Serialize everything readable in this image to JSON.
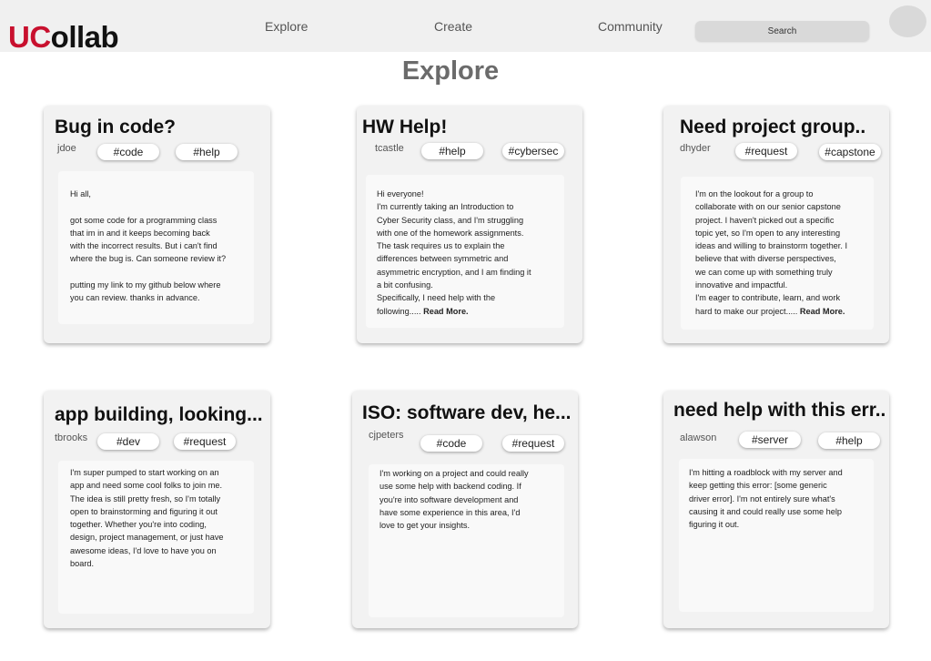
{
  "header": {
    "logo_accent": "UC",
    "logo_rest": "ollab",
    "nav": [
      "Explore",
      "Create",
      "Community"
    ],
    "search_placeholder": "Search"
  },
  "page_title": "Explore",
  "colors": {
    "brand_red": "#c8102e",
    "topbar": "#f0f0f0",
    "card": "#f2f2f2"
  },
  "posts": [
    {
      "title": "Bug in code?",
      "user": "jdoe",
      "tags": [
        "#code",
        "#help"
      ],
      "body": "Hi all,\n\ngot some code for a programming class\nthat im in and it keeps becoming back\nwith the incorrect results. But i can't find\nwhere the bug is. Can someone review it?\n\nputting my link to my github below where\nyou can review. thanks in advance.",
      "read_more": ""
    },
    {
      "title": "HW Help!",
      "user": "tcastle",
      "tags": [
        "#help",
        "#cybersec"
      ],
      "body": "Hi everyone!\nI'm currently taking an Introduction to\nCyber Security class, and I'm struggling\nwith one of the homework assignments.\nThe task requires us to explain the\ndifferences between symmetric and\nasymmetric encryption, and I am finding it\na bit confusing.\nSpecifically, I need help with the\nfollowing..... ",
      "read_more": "Read More."
    },
    {
      "title": "Need project group..",
      "user": "dhyder",
      "tags": [
        "#request",
        "#capstone"
      ],
      "body": "I'm on the lookout for a group to\ncollaborate with on our senior capstone\nproject. I haven't picked out a specific\ntopic yet, so I'm open to any interesting\nideas and willing to brainstorm together. I\nbelieve that with diverse perspectives,\nwe can come up with something truly\ninnovative and impactful.\nI'm eager to contribute, learn, and work\nhard to make our project..... ",
      "read_more": "Read More."
    },
    {
      "title": "app building, looking...",
      "user": "tbrooks",
      "tags": [
        "#dev",
        "#request"
      ],
      "body": "I'm super pumped to start working on an\napp and need some cool folks to join me.\nThe idea is still pretty fresh, so I'm totally\nopen to brainstorming and figuring it out\ntogether. Whether you're into coding,\ndesign, project management, or just have\nawesome ideas, I'd love to have you on\nboard.",
      "read_more": ""
    },
    {
      "title": "ISO: software dev, he...",
      "user": "cjpeters",
      "tags": [
        "#code",
        "#request"
      ],
      "body": "I'm working on a project and could really\nuse some help with backend coding. If\nyou're into software development and\nhave some experience in this area, I'd\nlove to get your insights.",
      "read_more": ""
    },
    {
      "title": "need help with this err..",
      "user": "alawson",
      "tags": [
        "#server",
        "#help"
      ],
      "body": "I'm hitting a roadblock with my server and\nkeep getting this error: [some generic\ndriver error]. I'm not entirely sure what's\ncausing it and could really use some help\nfiguring it out.",
      "read_more": ""
    }
  ]
}
